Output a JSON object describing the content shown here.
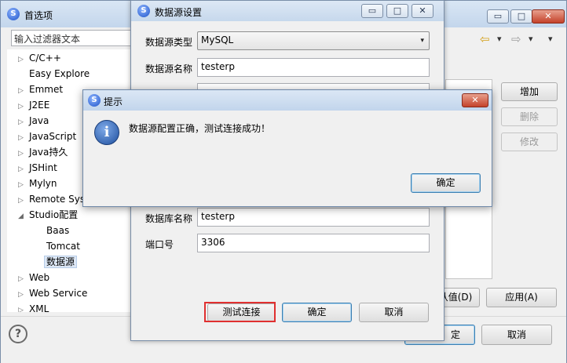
{
  "prefs": {
    "title": "首选项",
    "filter_placeholder": "输入过滤器文本",
    "tree": [
      {
        "label": "C/C++",
        "arrow": "▷"
      },
      {
        "label": "Easy Explore",
        "arrow": ""
      },
      {
        "label": "Emmet",
        "arrow": "▷"
      },
      {
        "label": "J2EE",
        "arrow": "▷"
      },
      {
        "label": "Java",
        "arrow": "▷"
      },
      {
        "label": "JavaScript",
        "arrow": "▷"
      },
      {
        "label": "Java持久",
        "arrow": "▷"
      },
      {
        "label": "JSHint",
        "arrow": "▷"
      },
      {
        "label": "Mylyn",
        "arrow": "▷"
      },
      {
        "label": "Remote Sys",
        "arrow": "▷"
      },
      {
        "label": "Studio配置",
        "arrow": "◢"
      },
      {
        "label": "Baas",
        "arrow": ""
      },
      {
        "label": "Tomcat",
        "arrow": ""
      },
      {
        "label": "数据源",
        "arrow": ""
      },
      {
        "label": "Web",
        "arrow": "▷"
      },
      {
        "label": "Web Service",
        "arrow": "▷"
      },
      {
        "label": "XML",
        "arrow": "▷"
      }
    ],
    "add_label": "增加",
    "delete_label": "删除",
    "edit_label": "修改",
    "restore_defaults_label": "认值(D)",
    "apply_label": "应用(A)",
    "ok_partial_label": "定",
    "cancel_label": "取消",
    "help_glyph": "?"
  },
  "datasource": {
    "title": "数据源设置",
    "type_label": "数据源类型",
    "type_value": "MySQL",
    "name_label": "数据源名称",
    "name_value": "testerp",
    "dbname_label": "数据库名称",
    "dbname_value": "testerp",
    "port_label": "端口号",
    "port_value": "3306",
    "test_label": "测试连接",
    "ok_label": "确定",
    "cancel_label": "取消"
  },
  "alert": {
    "title": "提示",
    "message": "数据源配置正确，测试连接成功！",
    "ok_label": "确定"
  },
  "icons": {
    "minimize": "▭",
    "maximize": "□",
    "close": "✕",
    "nav_back": "⇦",
    "nav_forward": "⇨",
    "menu_down": "▾",
    "app_glyph": "S",
    "info_glyph": "i"
  }
}
